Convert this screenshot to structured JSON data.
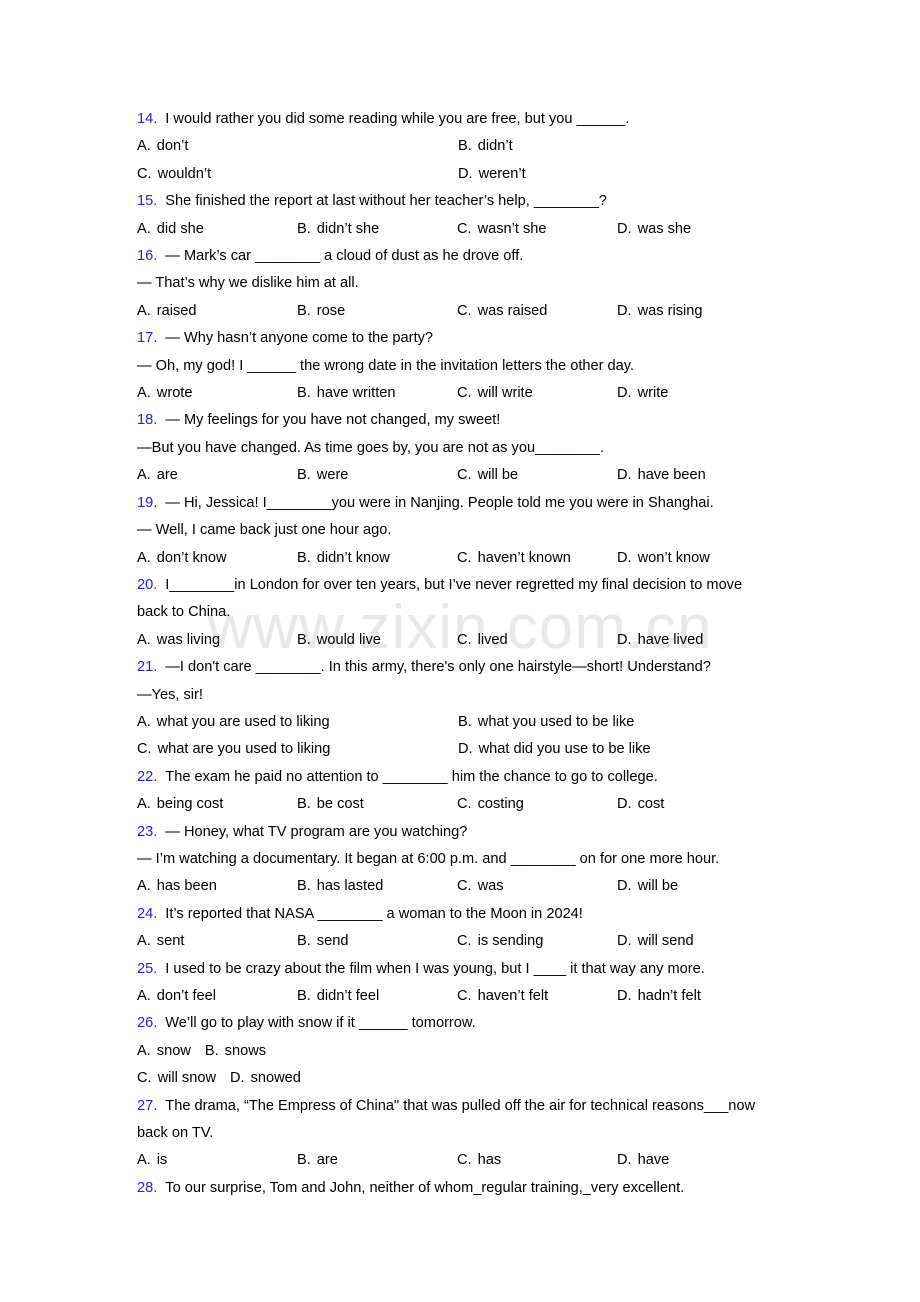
{
  "document": {
    "type": "english-grammar-multiple-choice-worksheet",
    "watermark": "www.zixin.com.cn",
    "number_color": "#2222dd",
    "text_color": "#000000"
  },
  "questions": [
    {
      "number": "14.",
      "layout": "cols2",
      "lines": [
        "I would rather you did some reading while you are free, but you ______."
      ],
      "options": [
        {
          "label": "A.",
          "text": "don’t"
        },
        {
          "label": "B.",
          "text": "didn’t"
        },
        {
          "label": "C.",
          "text": "wouldn’t"
        },
        {
          "label": "D.",
          "text": "weren’t"
        }
      ]
    },
    {
      "number": "15.",
      "layout": "cols4",
      "lines": [
        "She finished the report at last without her teacher’s help, ________?"
      ],
      "options": [
        {
          "label": "A.",
          "text": "did she"
        },
        {
          "label": "B.",
          "text": "didn’t she"
        },
        {
          "label": "C.",
          "text": "wasn’t she"
        },
        {
          "label": "D.",
          "text": "was she"
        }
      ]
    },
    {
      "number": "16.",
      "layout": "cols4",
      "lines": [
        "— Mark’s car ________ a cloud of dust as he drove off.",
        "— That’s why we dislike him at all."
      ],
      "options": [
        {
          "label": "A.",
          "text": "raised"
        },
        {
          "label": "B.",
          "text": "rose"
        },
        {
          "label": "C.",
          "text": "was raised"
        },
        {
          "label": "D.",
          "text": "was rising"
        }
      ]
    },
    {
      "number": "17.",
      "layout": "cols4",
      "lines": [
        "— Why hasn’t anyone come to the party?",
        "— Oh, my god! I ______ the wrong date in the invitation letters the other day."
      ],
      "options": [
        {
          "label": "A.",
          "text": "wrote"
        },
        {
          "label": "B.",
          "text": "have written"
        },
        {
          "label": "C.",
          "text": "will write"
        },
        {
          "label": "D.",
          "text": "write"
        }
      ]
    },
    {
      "number": "18.",
      "layout": "cols4",
      "lines": [
        "— My feelings for you have not changed, my sweet!",
        "—But you have changed. As time goes by, you are not as you________."
      ],
      "options": [
        {
          "label": "A.",
          "text": "are"
        },
        {
          "label": "B.",
          "text": "were"
        },
        {
          "label": "C.",
          "text": "will be"
        },
        {
          "label": "D.",
          "text": "have been"
        }
      ]
    },
    {
      "number": "19.",
      "layout": "cols4",
      "lines": [
        "— Hi, Jessica! I________you were in Nanjing. People told me you were in Shanghai.",
        "— Well, I came back just one hour ago."
      ],
      "options": [
        {
          "label": "A.",
          "text": "don’t know"
        },
        {
          "label": "B.",
          "text": "didn’t know"
        },
        {
          "label": "C.",
          "text": "haven’t known"
        },
        {
          "label": "D.",
          "text": "won’t know"
        }
      ]
    },
    {
      "number": "20.",
      "layout": "cols4",
      "lines": [
        "I________in London for over ten years, but I’ve never regretted my final decision to move",
        "back to China."
      ],
      "options": [
        {
          "label": "A.",
          "text": "was living"
        },
        {
          "label": "B.",
          "text": "would live"
        },
        {
          "label": "C.",
          "text": "lived"
        },
        {
          "label": "D.",
          "text": "have lived"
        }
      ]
    },
    {
      "number": "21.",
      "layout": "cols2",
      "lines": [
        "—I don't care ________. In this army, there's only one hairstyle—short! Understand?",
        "—Yes, sir!"
      ],
      "options": [
        {
          "label": "A.",
          "text": "what you are used to liking"
        },
        {
          "label": "B.",
          "text": "what you used to be like"
        },
        {
          "label": "C.",
          "text": "what are you used to liking"
        },
        {
          "label": "D.",
          "text": "what did you use to be like"
        }
      ]
    },
    {
      "number": "22.",
      "layout": "cols4",
      "lines": [
        "The exam he paid no attention to ________ him the chance to go to college."
      ],
      "options": [
        {
          "label": "A.",
          "text": "being cost"
        },
        {
          "label": "B.",
          "text": "be cost"
        },
        {
          "label": "C.",
          "text": "costing"
        },
        {
          "label": "D.",
          "text": "cost"
        }
      ]
    },
    {
      "number": "23.",
      "layout": "cols4",
      "lines": [
        "— Honey, what TV program are you watching?",
        "— I’m watching a documentary. It began at 6:00 p.m. and ________ on for one more hour."
      ],
      "options": [
        {
          "label": "A.",
          "text": "has been"
        },
        {
          "label": "B.",
          "text": "has lasted"
        },
        {
          "label": "C.",
          "text": "was"
        },
        {
          "label": "D.",
          "text": "will be"
        }
      ]
    },
    {
      "number": "24.",
      "layout": "cols4",
      "lines": [
        "It’s reported that NASA ________ a woman to the Moon in 2024!"
      ],
      "options": [
        {
          "label": "A.",
          "text": "sent"
        },
        {
          "label": "B.",
          "text": "send"
        },
        {
          "label": "C.",
          "text": "is sending"
        },
        {
          "label": "D.",
          "text": "will send"
        }
      ]
    },
    {
      "number": "25.",
      "layout": "cols4",
      "lines": [
        "I used to be crazy about the film when I was young, but I ____ it that way any more."
      ],
      "options": [
        {
          "label": "A.",
          "text": "don’t feel"
        },
        {
          "label": "B.",
          "text": "didn’t feel"
        },
        {
          "label": "C.",
          "text": "haven’t felt"
        },
        {
          "label": "D.",
          "text": "hadn’t felt"
        }
      ]
    },
    {
      "number": "26.",
      "layout": "inline2",
      "lines": [
        "We’ll go to play with snow if it ______ tomorrow."
      ],
      "options": [
        {
          "label": "A.",
          "text": "snow"
        },
        {
          "label": "B.",
          "text": "snows"
        },
        {
          "label": "C.",
          "text": "will snow"
        },
        {
          "label": "D.",
          "text": "snowed"
        }
      ]
    },
    {
      "number": "27.",
      "layout": "cols4",
      "lines": [
        "The drama, “The Empress of China\" that was pulled off the air for technical reasons___now",
        "back on TV."
      ],
      "options": [
        {
          "label": "A.",
          "text": "is"
        },
        {
          "label": "B.",
          "text": "are"
        },
        {
          "label": "C.",
          "text": "has"
        },
        {
          "label": "D.",
          "text": "have"
        }
      ]
    },
    {
      "number": "28.",
      "layout": "none",
      "lines": [
        "To our surprise, Tom and John, neither of whom_regular training,_very excellent."
      ],
      "options": []
    }
  ]
}
